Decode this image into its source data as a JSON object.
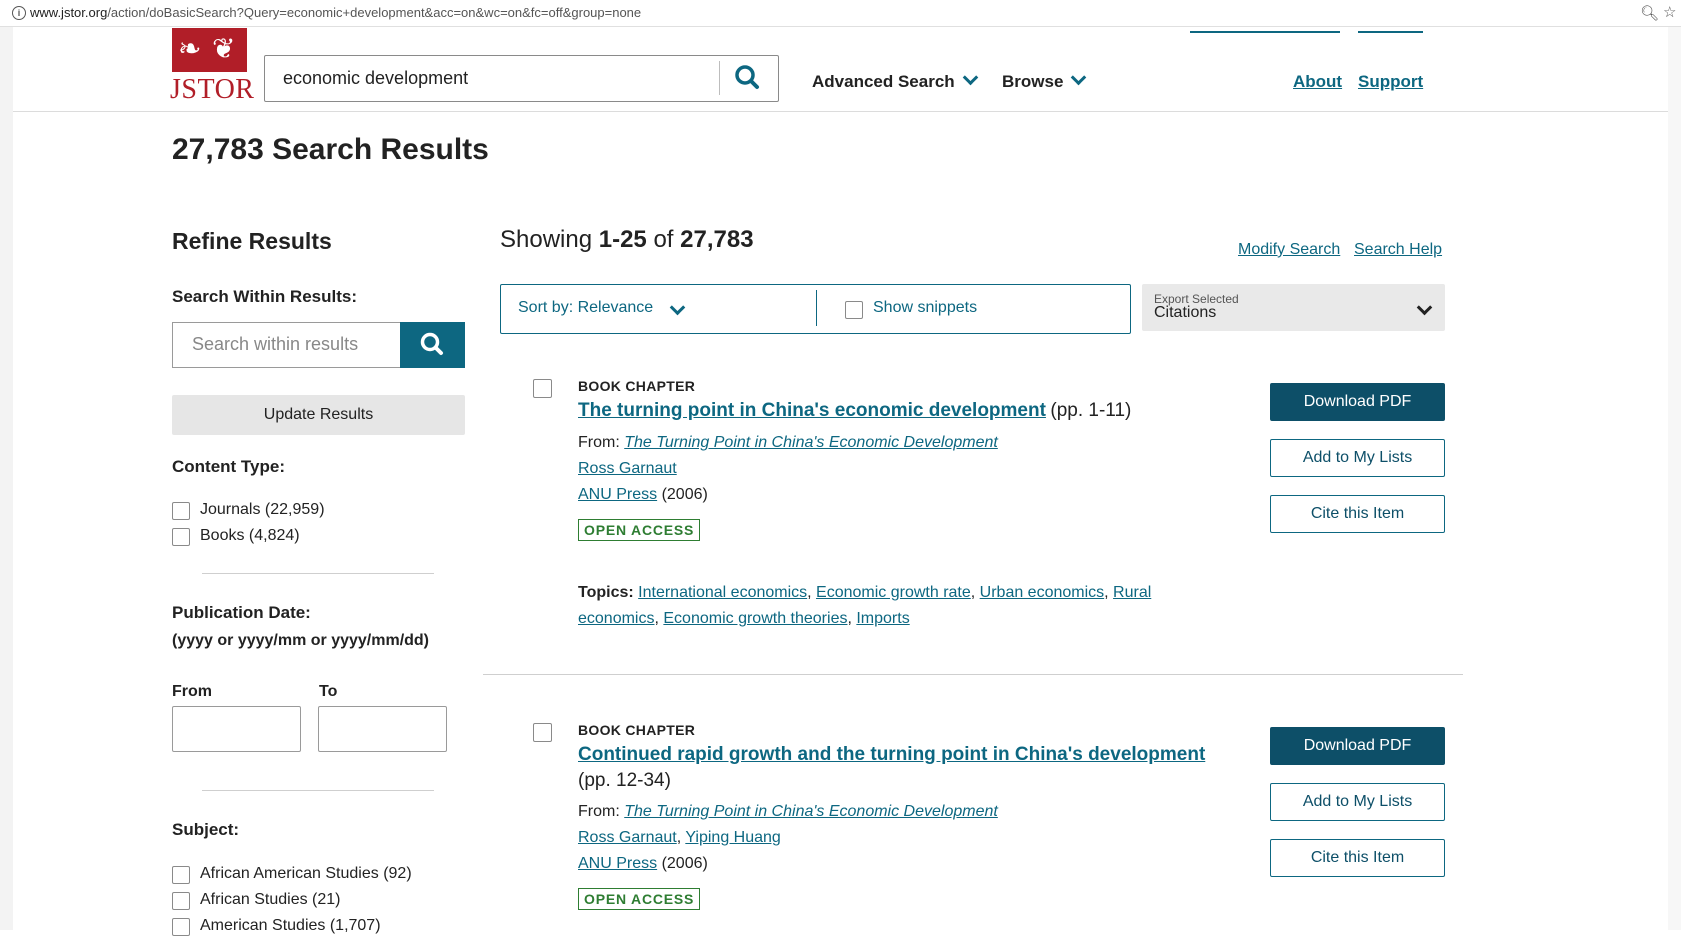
{
  "browser": {
    "url_domain": "www.jstor.org",
    "url_path": "/action/doBasicSearch?Query=economic+development&acc=on&wc=on&fc=off&group=none"
  },
  "header": {
    "logo_text": "JSTOR",
    "search_value": "economic development",
    "nav": {
      "advanced_search": "Advanced Search",
      "browse": "Browse",
      "about": "About",
      "support": "Support"
    }
  },
  "page": {
    "results_title": "27,783 Search Results",
    "showing_prefix": "Showing ",
    "showing_range": "1-25",
    "showing_of": " of ",
    "showing_total": "27,783",
    "modify_search": "Modify Search",
    "search_help": "Search Help"
  },
  "sidebar": {
    "title": "Refine Results",
    "within_label": "Search Within Results:",
    "within_placeholder": "Search within results",
    "update_button": "Update Results",
    "content_type_label": "Content Type:",
    "content_types": [
      {
        "label": "Journals (22,959)"
      },
      {
        "label": "Books (4,824)"
      }
    ],
    "pub_date_label": "Publication Date:",
    "pub_date_format": "(yyyy or yyyy/mm or yyyy/mm/dd)",
    "from_label": "From",
    "to_label": "To",
    "subject_label": "Subject:",
    "subjects": [
      {
        "label": "African American Studies (92)"
      },
      {
        "label": "African Studies (21)"
      },
      {
        "label": "American Studies (1,707)"
      }
    ]
  },
  "toolbar": {
    "sort_label": "Sort by: Relevance",
    "snippets_label": "Show snippets",
    "export_small": "Export Selected",
    "export_main": "Citations"
  },
  "results": [
    {
      "type": "BOOK CHAPTER",
      "title": "The turning point in China's economic development",
      "pages": "(pp. 1-11)",
      "from_label": "From: ",
      "from_title": "The Turning Point in China's Economic Development",
      "authors": [
        "Ross Garnaut"
      ],
      "publisher": "ANU Press",
      "year": " (2006)",
      "access": "OPEN ACCESS",
      "topics_label": "Topics: ",
      "topics": [
        "International economics",
        "Economic growth rate",
        "Urban economics",
        "Rural economics",
        "Economic growth theories",
        "Imports"
      ],
      "buttons": {
        "download": "Download PDF",
        "add": "Add to My Lists",
        "cite": "Cite this Item"
      }
    },
    {
      "type": "BOOK CHAPTER",
      "title": "Continued rapid growth and the turning point in China's development",
      "pages": "(pp. 12-34)",
      "from_label": "From: ",
      "from_title": "The Turning Point in China's Economic Development",
      "authors": [
        "Ross Garnaut",
        "Yiping Huang"
      ],
      "publisher": "ANU Press",
      "year": " (2006)",
      "access": "OPEN ACCESS",
      "buttons": {
        "download": "Download PDF",
        "add": "Add to My Lists",
        "cite": "Cite this Item"
      }
    }
  ],
  "colors": {
    "brand_red": "#b11e28",
    "link_teal": "#0d6781",
    "button_dark": "#0d4f68",
    "open_access_green": "#2e7d32"
  }
}
